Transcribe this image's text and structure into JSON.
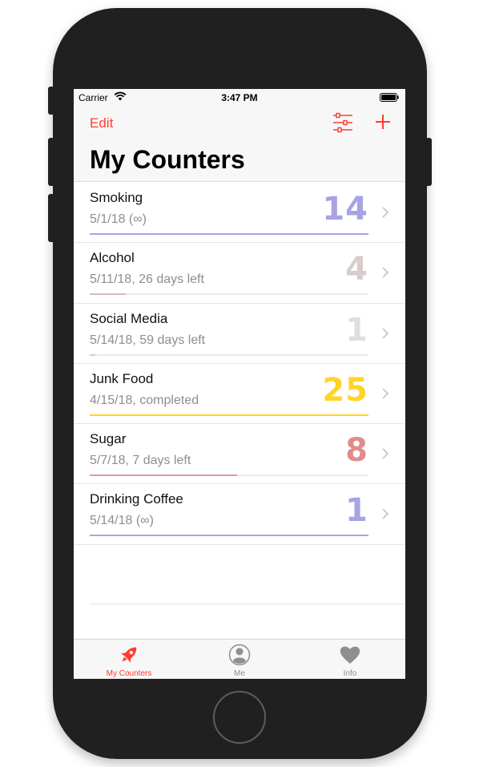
{
  "status_bar": {
    "carrier": "Carrier",
    "time": "3:47 PM"
  },
  "nav": {
    "edit_label": "Edit",
    "title": "My Counters"
  },
  "counters": [
    {
      "name": "Smoking",
      "subtitle": "5/1/18 (∞)",
      "count": "14",
      "color": "#a7a3e4",
      "bar_color": "#a7a3e4",
      "progress_fraction": 1.0
    },
    {
      "name": "Alcohol",
      "subtitle": "5/11/18, 26 days left",
      "count": "4",
      "color": "#d9cccc",
      "bar_color": "#d9b8b8",
      "progress_fraction": 0.13
    },
    {
      "name": "Social Media",
      "subtitle": "5/14/18, 59 days left",
      "count": "1",
      "color": "#dedede",
      "bar_color": "#d0d0d0",
      "progress_fraction": 0.02
    },
    {
      "name": "Junk Food",
      "subtitle": "4/15/18, completed",
      "count": "25",
      "color": "#ffd426",
      "bar_color": "#ffd426",
      "progress_fraction": 1.0
    },
    {
      "name": "Sugar",
      "subtitle": "5/7/18, 7 days left",
      "count": "8",
      "color": "#e08c8c",
      "bar_color": "#e09a9a",
      "progress_fraction": 0.53
    },
    {
      "name": "Drinking Coffee",
      "subtitle": "5/14/18 (∞)",
      "count": "1",
      "color": "#a7a3e4",
      "bar_color": "#a7a3e4",
      "progress_fraction": 1.0
    }
  ],
  "tabs": [
    {
      "label": "My Counters",
      "icon": "rocket-icon",
      "active": true
    },
    {
      "label": "Me",
      "icon": "person-icon",
      "active": false
    },
    {
      "label": "Info",
      "icon": "heart-icon",
      "active": false
    }
  ],
  "colors": {
    "accent": "#ff3b30",
    "inactive_tab": "#8e8e93"
  }
}
